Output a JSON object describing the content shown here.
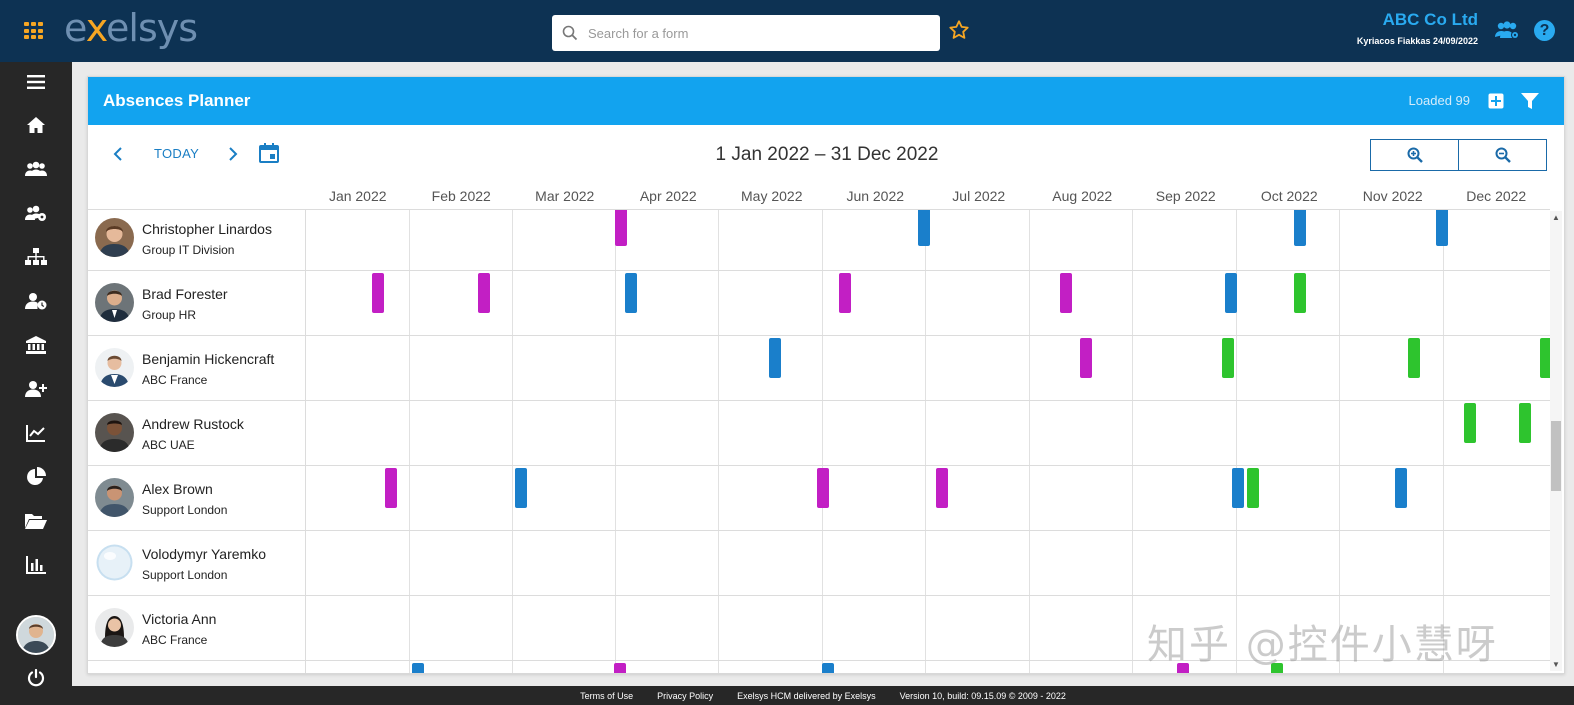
{
  "topbar": {
    "logo_prefix": "e",
    "logo_x": "x",
    "logo_suffix": "elsys",
    "search_placeholder": "Search for a form",
    "company_name": "ABC Co Ltd",
    "user_line": "Kyriacos Fiakkas 24/09/2022",
    "help_label": "?"
  },
  "sidebar": {
    "items": [
      "menu-icon",
      "home-icon",
      "users-icon",
      "users-settings-icon",
      "org-chart-icon",
      "user-clock-icon",
      "bank-icon",
      "user-plus-icon",
      "line-chart-icon",
      "pie-chart-icon",
      "folder-open-icon",
      "bar-chart-icon"
    ],
    "bottom": [
      "avatar",
      "power-icon"
    ]
  },
  "panel": {
    "title": "Absences Planner",
    "loaded": "Loaded 99",
    "today_label": "TODAY",
    "date_range": "1 Jan 2022 – 31 Dec 2022",
    "months": [
      "Jan 2022",
      "Feb 2022",
      "Mar 2022",
      "Apr 2022",
      "May 2022",
      "Jun 2022",
      "Jul 2022",
      "Aug 2022",
      "Sep 2022",
      "Oct 2022",
      "Nov 2022",
      "Dec 2022"
    ]
  },
  "colors": {
    "purple": "#c21fc4",
    "blue": "#1a7fcb",
    "green": "#2ec42e",
    "header_blue": "#12a3ef",
    "topbar": "#0d3253",
    "accent_orange": "#f6a623"
  },
  "employees": [
    {
      "name": "Christopher Linardos",
      "dept": "Group IT Division",
      "absences": [
        [
          "purple",
          "Apr"
        ],
        [
          "blue",
          "Jul"
        ],
        [
          "blue",
          "Oct"
        ],
        [
          "blue",
          "Dec"
        ]
      ]
    },
    {
      "name": "Brad Forester",
      "dept": "Group HR",
      "absences": [
        [
          "purple",
          "Jan"
        ],
        [
          "purple",
          "Feb"
        ],
        [
          "blue",
          "Apr"
        ],
        [
          "purple",
          "Jun"
        ],
        [
          "purple",
          "Aug"
        ],
        [
          "blue",
          "Sep"
        ],
        [
          "green",
          "Oct"
        ]
      ]
    },
    {
      "name": "Benjamin Hickencraft",
      "dept": "ABC France",
      "absences": [
        [
          "blue",
          "May"
        ],
        [
          "purple",
          "Aug"
        ],
        [
          "green",
          "Sep"
        ],
        [
          "green",
          "Nov"
        ],
        [
          "green",
          "Dec"
        ]
      ]
    },
    {
      "name": "Andrew Rustock",
      "dept": "ABC UAE",
      "absences": [
        [
          "green",
          "Dec"
        ],
        [
          "green",
          "Dec"
        ]
      ]
    },
    {
      "name": "Alex Brown",
      "dept": "Support London",
      "absences": [
        [
          "purple",
          "Jan"
        ],
        [
          "blue",
          "Feb"
        ],
        [
          "purple",
          "Jun"
        ],
        [
          "purple",
          "Jul"
        ],
        [
          "blue",
          "Sep"
        ],
        [
          "green",
          "Oct"
        ],
        [
          "blue",
          "Nov"
        ]
      ]
    },
    {
      "name": "Volodymyr Yaremko",
      "dept": "Support London",
      "absences": []
    },
    {
      "name": "Victoria Ann",
      "dept": "ABC France",
      "absences": []
    },
    {
      "name": "",
      "dept": "",
      "absences": [
        [
          "blue",
          "Feb"
        ],
        [
          "purple",
          "Apr"
        ],
        [
          "blue",
          "Jun"
        ],
        [
          "purple",
          "Sep"
        ],
        [
          "green",
          "Oct"
        ]
      ]
    }
  ],
  "footer": {
    "links": [
      "Terms of Use",
      "Privacy Policy",
      "Exelsys HCM delivered by Exelsys",
      "Version 10, build: 09.15.09 © 2009 - 2022"
    ]
  },
  "watermark": "知乎 @控件小慧呀"
}
